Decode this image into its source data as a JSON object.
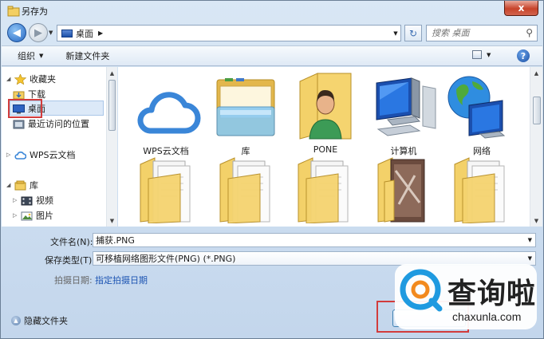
{
  "window": {
    "title": "另存为",
    "close_label": "x"
  },
  "address": {
    "breadcrumb": "桌面",
    "search_placeholder": "搜索 桌面"
  },
  "toolbar": {
    "organize_label": "组织",
    "new_folder_label": "新建文件夹"
  },
  "nav": {
    "favorites_label": "收藏夹",
    "downloads_label": "下载",
    "desktop_label": "桌面",
    "recent_label": "最近访问的位置",
    "wps_label": "WPS云文档",
    "libraries_label": "库",
    "videos_label": "视频",
    "pictures_label": "图片"
  },
  "items": [
    {
      "label": "WPS云文档",
      "icon": "cloud-icon"
    },
    {
      "label": "库",
      "icon": "library-icon"
    },
    {
      "label": "PONE",
      "icon": "user-folder-icon"
    },
    {
      "label": "计算机",
      "icon": "computer-icon"
    },
    {
      "label": "网络",
      "icon": "network-icon"
    },
    {
      "label": "",
      "icon": "folder-icon"
    },
    {
      "label": "",
      "icon": "folder-icon"
    },
    {
      "label": "",
      "icon": "folder-icon"
    },
    {
      "label": "",
      "icon": "photo-folder-icon"
    },
    {
      "label": "",
      "icon": "folder-icon"
    }
  ],
  "form": {
    "filename_label": "文件名(N):",
    "filename_value": "捕获.PNG",
    "filetype_label": "保存类型(T):",
    "filetype_value": "可移植网络图形文件(PNG) (*.PNG)",
    "date_label": "拍摄日期:",
    "date_link": "指定拍摄日期"
  },
  "footer": {
    "hide_folders_label": "隐藏文件夹"
  },
  "watermark": {
    "brand": "查询啦",
    "url": "chaxunla.com"
  },
  "colors": {
    "accent": "#1d55b3",
    "highlight_box": "#d23c3c",
    "watermark_logo": "#1f9ae0"
  }
}
